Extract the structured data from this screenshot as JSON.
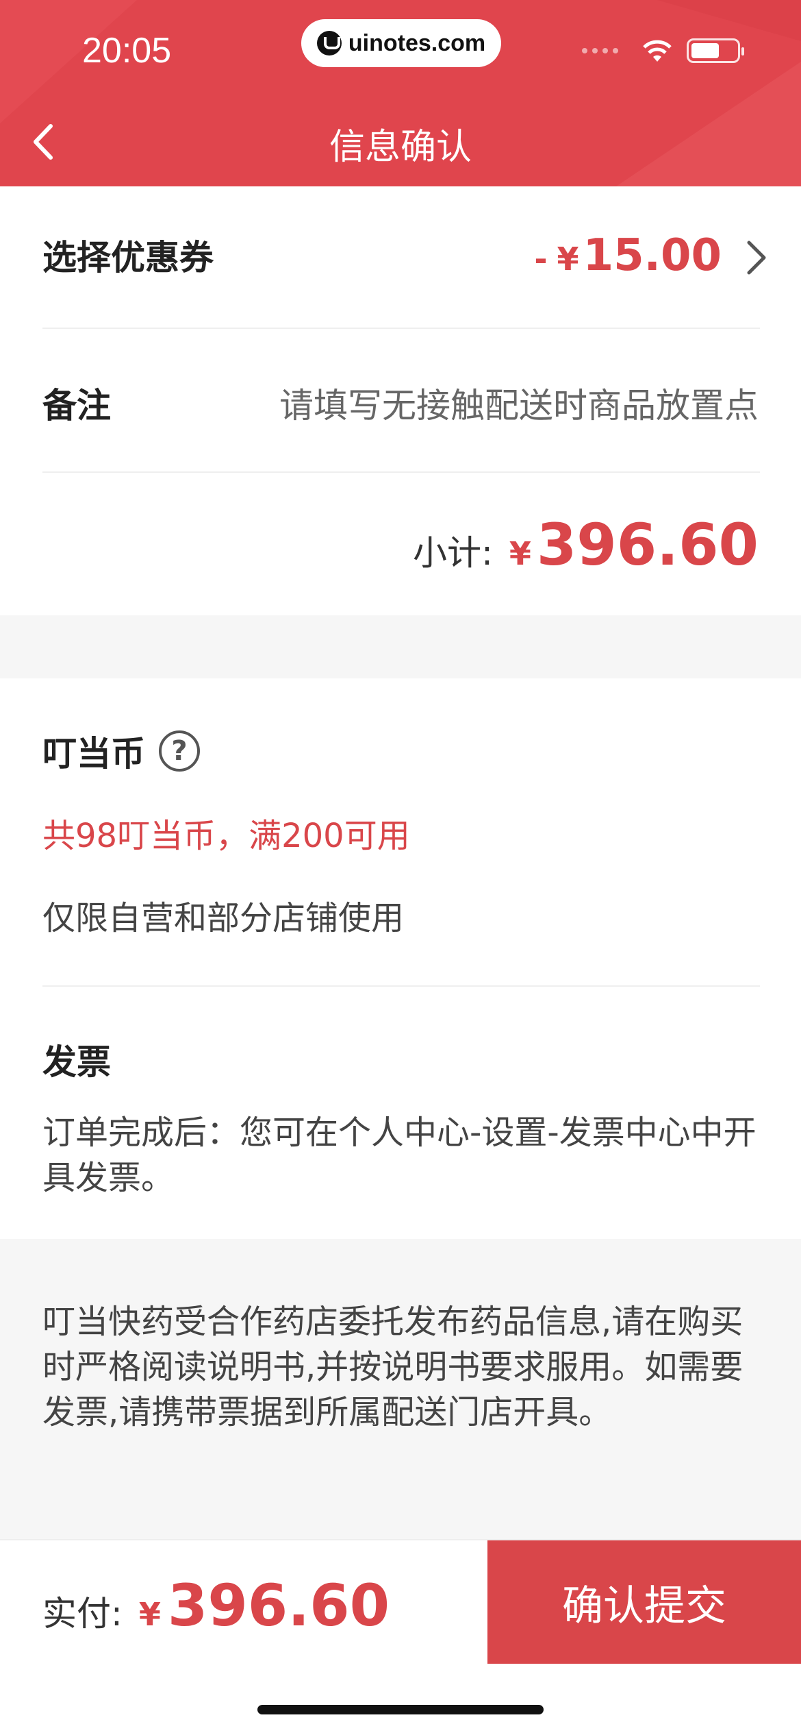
{
  "status_bar": {
    "time": "20:05",
    "url": "uinotes.com"
  },
  "nav": {
    "title": "信息确认"
  },
  "coupon": {
    "label": "选择优惠券",
    "minus": "-",
    "currency": "¥",
    "value": "15.00"
  },
  "remark": {
    "label": "备注",
    "placeholder": "请填写无接触配送时商品放置点"
  },
  "subtotal": {
    "label": "小计:",
    "currency": "¥",
    "value": "396.60"
  },
  "coins": {
    "title": "叮当币",
    "help_symbol": "?",
    "info": "共98叮当币，满200可用",
    "note": "仅限自营和部分店铺使用"
  },
  "invoice": {
    "title": "发票",
    "text": "订单完成后：您可在个人中心-设置-发票中心中开具发票。"
  },
  "notice": {
    "text": "叮当快药受合作药店委托发布药品信息,请在购买时严格阅读说明书,并按说明书要求服用。如需要发票,请携带票据到所属配送门店开具。"
  },
  "footer": {
    "paid_label": "实付:",
    "currency": "¥",
    "paid_value": "396.60",
    "submit_label": "确认提交"
  },
  "colors": {
    "header_bg": "#e0454d",
    "accent_red": "#d9464a",
    "band_gray": "#f6f6f6"
  }
}
